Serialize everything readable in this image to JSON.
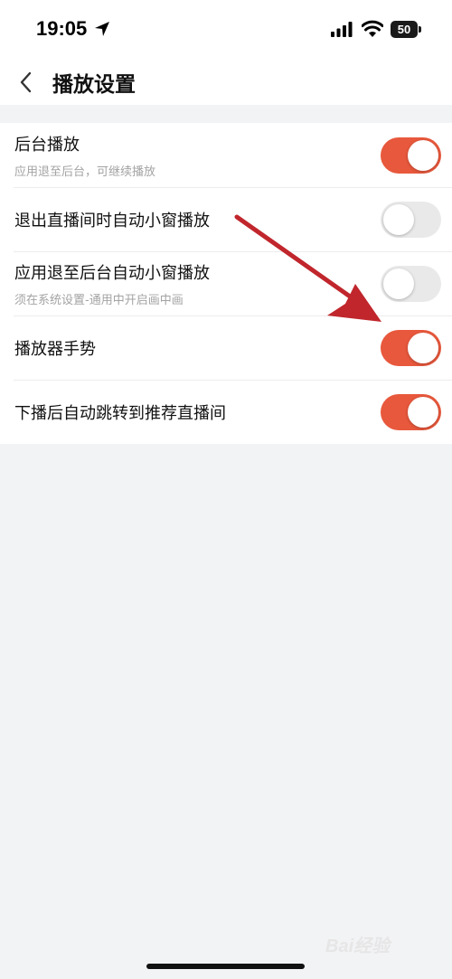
{
  "status_bar": {
    "time": "19:05",
    "battery_level": "50",
    "icons": [
      "location-arrow-icon",
      "signal-icon",
      "wifi-icon",
      "battery-icon"
    ]
  },
  "header": {
    "back_icon": "chevron-left-icon",
    "title": "播放设置"
  },
  "settings": [
    {
      "title": "后台播放",
      "subtitle": "应用退至后台，可继续播放",
      "enabled": true
    },
    {
      "title": "退出直播间时自动小窗播放",
      "subtitle": "",
      "enabled": false
    },
    {
      "title": "应用退至后台自动小窗播放",
      "subtitle": "须在系统设置-通用中开启画中画",
      "enabled": false
    },
    {
      "title": "播放器手势",
      "subtitle": "",
      "enabled": true
    },
    {
      "title": "下播后自动跳转到推荐直播间",
      "subtitle": "",
      "enabled": true
    }
  ],
  "colors": {
    "toggle_on": "#e8583c",
    "toggle_off": "#e9e9ea",
    "annotation_arrow": "#c0262c"
  },
  "watermark": "Bai经验"
}
